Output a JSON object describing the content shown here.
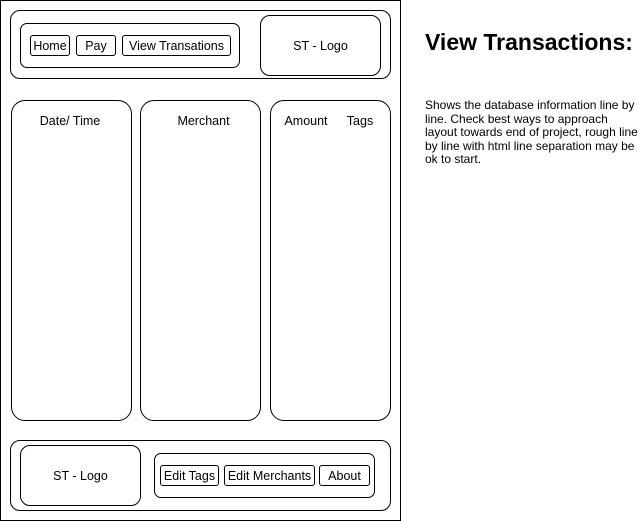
{
  "header": {
    "nav": {
      "home_label": "Home",
      "pay_label": "Pay",
      "view_transactions_label": "View Transations"
    },
    "logo_label": "ST - Logo"
  },
  "columns": {
    "datetime_label": "Date/ Time",
    "merchant_label": "Merchant",
    "amount_label": "Amount",
    "tags_label": "Tags"
  },
  "footer": {
    "logo_label": "ST - Logo",
    "nav": {
      "edit_tags_label": "Edit Tags",
      "edit_merchants_label": "Edit Merchants",
      "about_label": "About"
    }
  },
  "annotation": {
    "title": "View Transactions:",
    "description": "Shows the database information line by line. Check best ways to approach layout towards end of project, rough line by line with html line separation may be ok to start."
  }
}
